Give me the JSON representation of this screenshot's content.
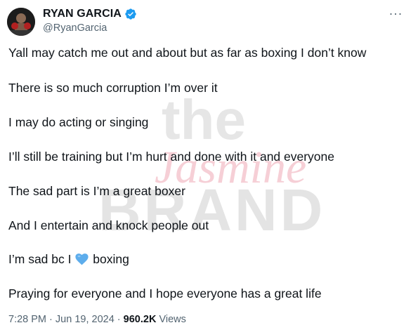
{
  "author": {
    "display_name": "RYAN GARCIA",
    "handle": "@RyanGarcia",
    "verified": true,
    "verified_color": "#1d9bf0"
  },
  "menu": {
    "more_label": "···"
  },
  "tweet": {
    "lines": [
      "Yall may catch me out and about but as far as boxing I don’t know",
      "There is so much corruption I’m over it",
      "I may do acting or singing",
      "I’ll still be training but I’m hurt and done with it and everyone",
      "The sad part is I’m a great boxer",
      "And I entertain and knock people out",
      "I’m sad bc I",
      "boxing",
      "Praying for everyone and I hope everyone has a great life"
    ],
    "emoji": "blue-heart-icon"
  },
  "meta": {
    "time": "7:28 PM",
    "separator": "·",
    "date": "Jun 19, 2024",
    "views_count": "960.2K",
    "views_label": "Views"
  },
  "watermark": {
    "line1": "the",
    "line2": "Jasmine",
    "line3": "BRAND"
  }
}
